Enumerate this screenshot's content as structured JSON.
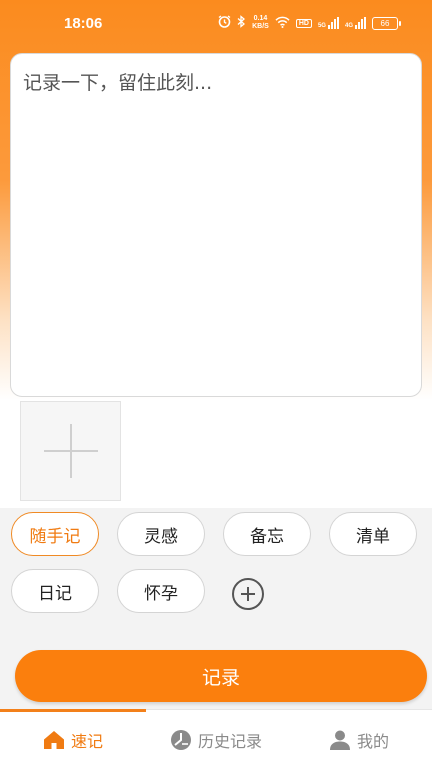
{
  "status_bar": {
    "time": "18:06",
    "net_speed_value": "0.14",
    "net_speed_unit": "KB/S",
    "hd_label": "HD",
    "signal1_label": "5G",
    "signal2_label": "4G",
    "battery": "66"
  },
  "note": {
    "placeholder": "记录一下，留住此刻..."
  },
  "tags": [
    {
      "label": "随手记",
      "active": true
    },
    {
      "label": "灵感",
      "active": false
    },
    {
      "label": "备忘",
      "active": false
    },
    {
      "label": "清单",
      "active": false
    },
    {
      "label": "日记",
      "active": false
    },
    {
      "label": "怀孕",
      "active": false
    }
  ],
  "record_button": "记录",
  "tabbar": {
    "items": [
      {
        "label": "速记",
        "icon": "home-icon",
        "active": true
      },
      {
        "label": "历史记录",
        "icon": "history-icon",
        "active": false
      },
      {
        "label": "我的",
        "icon": "person-icon",
        "active": false
      }
    ]
  },
  "colors": {
    "accent": "#fb7f0d",
    "background_gradient_top": "#fb8b1e"
  }
}
